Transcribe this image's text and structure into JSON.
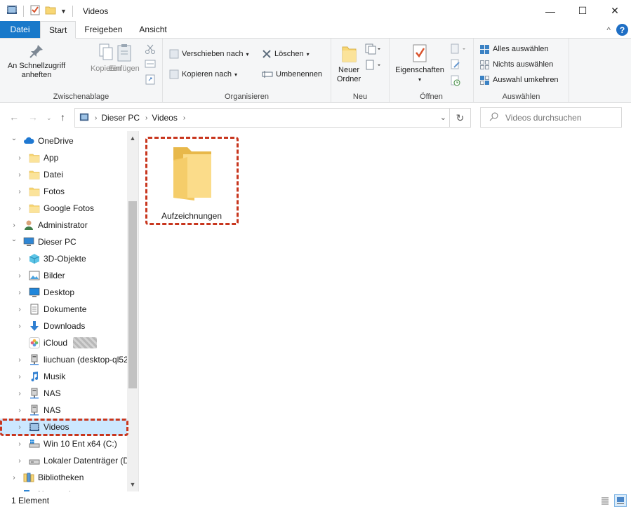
{
  "window": {
    "title": "Videos",
    "minimize_glyph": "—",
    "maximize_glyph": "☐",
    "close_glyph": "✕"
  },
  "tabs": {
    "file": "Datei",
    "start": "Start",
    "share": "Freigeben",
    "view": "Ansicht",
    "collapse_glyph": "^",
    "help_glyph": "?"
  },
  "ribbon": {
    "clipboard": {
      "label": "Zwischenablage",
      "pin_line1": "An Schnellzugriff",
      "pin_line2": "anheften",
      "copy": "Kopieren",
      "paste": "Einfügen"
    },
    "organize": {
      "label": "Organisieren",
      "move_to": "Verschieben nach",
      "copy_to": "Kopieren nach",
      "delete": "Löschen",
      "rename": "Umbenennen"
    },
    "new": {
      "label": "Neu",
      "new_folder_line1": "Neuer",
      "new_folder_line2": "Ordner"
    },
    "open": {
      "label": "Öffnen",
      "properties": "Eigenschaften"
    },
    "select": {
      "label": "Auswählen",
      "select_all": "Alles auswählen",
      "select_none": "Nichts auswählen",
      "invert": "Auswahl umkehren"
    }
  },
  "address": {
    "crumbs": [
      "Dieser PC",
      "Videos"
    ],
    "search_placeholder": "Videos durchsuchen"
  },
  "nav": {
    "items": [
      {
        "label": "OneDrive",
        "level": 0,
        "expanded": true,
        "icon": "cloud-icon"
      },
      {
        "label": "App",
        "level": 1,
        "icon": "folder-icon"
      },
      {
        "label": "Datei",
        "level": 1,
        "icon": "folder-icon"
      },
      {
        "label": "Fotos",
        "level": 1,
        "icon": "folder-icon"
      },
      {
        "label": "Google Fotos",
        "level": 1,
        "icon": "folder-icon"
      },
      {
        "label": "Administrator",
        "level": 0,
        "icon": "user-icon"
      },
      {
        "label": "Dieser PC",
        "level": 0,
        "expanded": true,
        "icon": "computer-icon"
      },
      {
        "label": "3D-Objekte",
        "level": 1,
        "icon": "cube-icon"
      },
      {
        "label": "Bilder",
        "level": 1,
        "icon": "pictures-icon"
      },
      {
        "label": "Desktop",
        "level": 1,
        "icon": "desktop-icon"
      },
      {
        "label": "Dokumente",
        "level": 1,
        "icon": "document-icon"
      },
      {
        "label": "Downloads",
        "level": 1,
        "icon": "download-icon"
      },
      {
        "label": "iCloud",
        "level": 1,
        "icon": "icloud-photos-icon",
        "no_expander": true
      },
      {
        "label": "liuchuan (desktop-ql52",
        "level": 1,
        "icon": "network-drive-icon"
      },
      {
        "label": "Musik",
        "level": 1,
        "icon": "music-icon"
      },
      {
        "label": "NAS",
        "level": 1,
        "icon": "network-drive-icon"
      },
      {
        "label": "NAS",
        "level": 1,
        "icon": "network-drive-icon"
      },
      {
        "label": "Videos",
        "level": 1,
        "icon": "video-icon",
        "selected": true
      },
      {
        "label": "Win 10 Ent x64 (C:)",
        "level": 1,
        "icon": "system-drive-icon"
      },
      {
        "label": "Lokaler Datenträger (D",
        "level": 1,
        "icon": "drive-icon"
      },
      {
        "label": "Bibliotheken",
        "level": 0,
        "icon": "library-icon"
      },
      {
        "label": "Netzwerk",
        "level": 0,
        "icon": "network-icon"
      }
    ]
  },
  "content": {
    "items": [
      {
        "label": "Aufzeichnungen",
        "icon": "folder-icon"
      }
    ]
  },
  "status": {
    "count": "1 Element"
  },
  "colors": {
    "accent": "#1979ca",
    "selection": "#cce8ff",
    "highlight_outline": "#c8361e",
    "folder_yellow": "#f8d775"
  }
}
